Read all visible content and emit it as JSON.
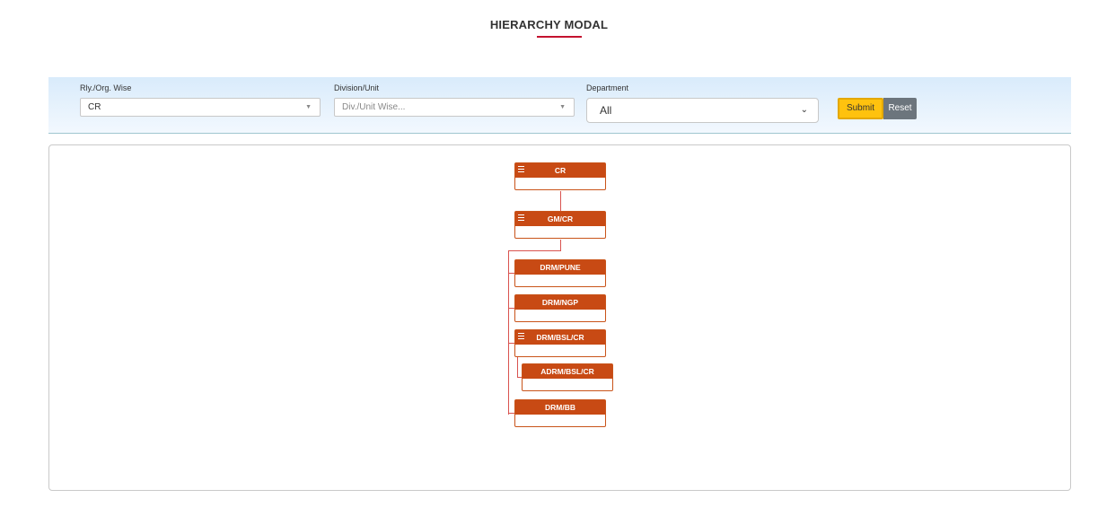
{
  "header": {
    "title": "HIERARCHY MODAL"
  },
  "filters": {
    "rly_label": "Rly./Org. Wise",
    "rly_value": "CR",
    "division_label": "Division/Unit",
    "division_placeholder": "Div./Unit Wise...",
    "department_label": "Department",
    "department_value": "All",
    "submit_label": "Submit",
    "reset_label": "Reset"
  },
  "hierarchy": {
    "nodes": [
      {
        "id": "cr",
        "label": "CR",
        "has_menu": true
      },
      {
        "id": "gm",
        "label": "GM/CR",
        "has_menu": true
      },
      {
        "id": "pune",
        "label": "DRM/PUNE",
        "has_menu": false
      },
      {
        "id": "ngp",
        "label": "DRM/NGP",
        "has_menu": false
      },
      {
        "id": "bsl",
        "label": "DRM/BSL/CR",
        "has_menu": true
      },
      {
        "id": "adrm",
        "label": "ADRM/BSL/CR",
        "has_menu": false
      },
      {
        "id": "bb",
        "label": "DRM/BB",
        "has_menu": false
      }
    ]
  },
  "colors": {
    "accent_underline": "#c4122f",
    "node_header": "#c84a14",
    "connector": "#d9534f",
    "submit_bg": "#ffc20e",
    "reset_bg": "#6c757d"
  }
}
